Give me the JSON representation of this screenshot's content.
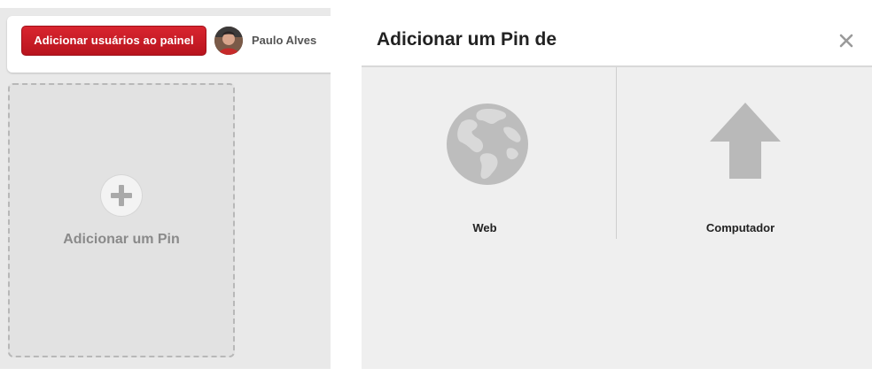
{
  "board_header": {
    "add_users_button_label": "Adicionar usuários ao painel",
    "user_name": "Paulo Alves"
  },
  "add_pin_tile": {
    "label": "Adicionar um Pin",
    "icon": "plus-icon"
  },
  "modal": {
    "title": "Adicionar um Pin de",
    "close_icon": "close-icon",
    "options": [
      {
        "label": "Web",
        "icon": "globe-icon"
      },
      {
        "label": "Computador",
        "icon": "upload-arrow-icon"
      }
    ]
  },
  "colors": {
    "primary_button": "#cb1f27",
    "icon_gray": "#b9b9b9",
    "panel_bg": "#efefef"
  }
}
